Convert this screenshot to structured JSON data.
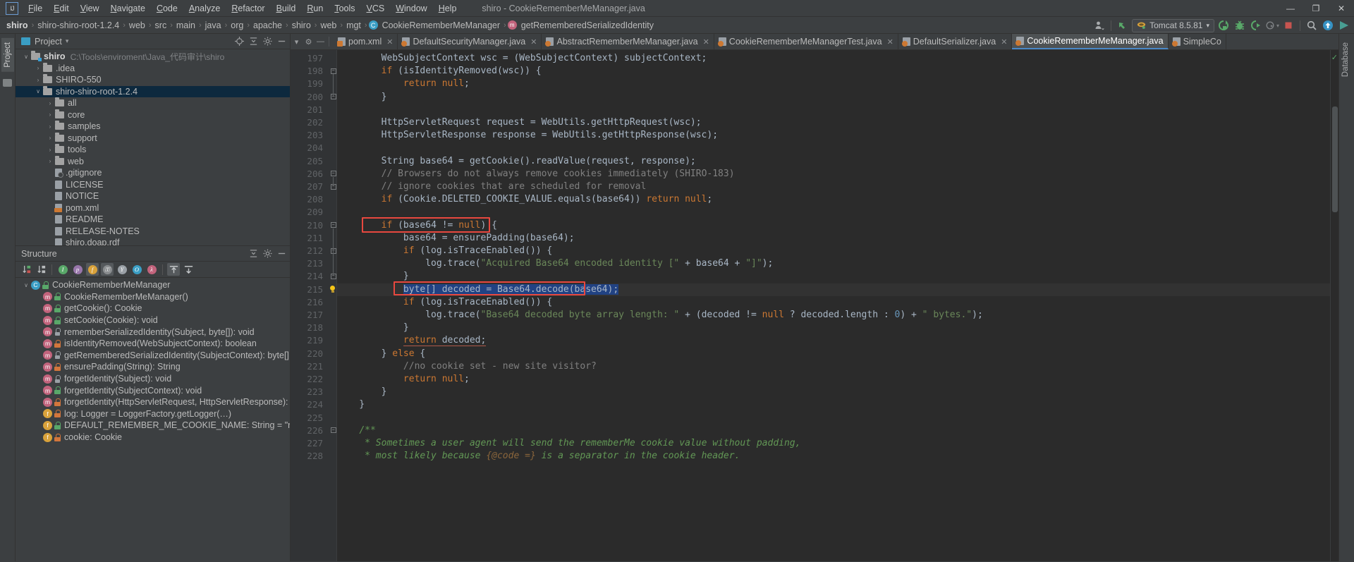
{
  "titlebar": {
    "logo": "IJ",
    "menus": [
      "File",
      "Edit",
      "View",
      "Navigate",
      "Code",
      "Analyze",
      "Refactor",
      "Build",
      "Run",
      "Tools",
      "VCS",
      "Window",
      "Help"
    ],
    "window_title": "shiro - CookieRememberMeManager.java",
    "minimize": "—",
    "maximize": "❐",
    "close": "✕"
  },
  "navbar": {
    "breadcrumbs": [
      {
        "label": "shiro",
        "bold": true,
        "icon": ""
      },
      {
        "label": "shiro-shiro-root-1.2.4",
        "bold": false,
        "icon": ""
      },
      {
        "label": "web",
        "bold": false,
        "icon": ""
      },
      {
        "label": "src",
        "bold": false,
        "icon": ""
      },
      {
        "label": "main",
        "bold": false,
        "icon": ""
      },
      {
        "label": "java",
        "bold": false,
        "icon": ""
      },
      {
        "label": "org",
        "bold": false,
        "icon": ""
      },
      {
        "label": "apache",
        "bold": false,
        "icon": ""
      },
      {
        "label": "shiro",
        "bold": false,
        "icon": ""
      },
      {
        "label": "web",
        "bold": false,
        "icon": ""
      },
      {
        "label": "mgt",
        "bold": false,
        "icon": ""
      },
      {
        "label": "CookieRememberMeManager",
        "bold": false,
        "icon": "class-icon",
        "badge": "C"
      },
      {
        "label": "getRememberedSerializedIdentity",
        "bold": false,
        "icon": "method-icon",
        "badge": "m"
      }
    ],
    "separator": "›",
    "run_config": "Tomcat 8.5.81",
    "toolbar_icons": [
      {
        "name": "user-icon",
        "glyph": "♟"
      },
      {
        "name": "update-project-icon",
        "glyph": "↖"
      },
      {
        "name": "run-icon",
        "glyph": "↻"
      },
      {
        "name": "debug-icon",
        "glyph": "☢"
      },
      {
        "name": "run-with-coverage-icon",
        "glyph": "▷"
      },
      {
        "name": "profile-icon",
        "glyph": "◴"
      },
      {
        "name": "stop-icon",
        "glyph": "■"
      },
      {
        "name": "search-everywhere-icon",
        "glyph": "⚲"
      },
      {
        "name": "upload-icon",
        "glyph": "↑"
      },
      {
        "name": "play-colored-icon",
        "glyph": "▶"
      }
    ]
  },
  "left_strip": {
    "project_tab": "Project",
    "structure_tab": ""
  },
  "right_strip": {
    "database_tab": "Database"
  },
  "project_panel": {
    "title": "Project",
    "dropdown": "▾",
    "actions": [
      "target-icon",
      "collapse-all-icon",
      "settings-icon",
      "hide-icon"
    ],
    "tree": [
      {
        "depth": 0,
        "arrow": "∨",
        "icon": "folder-module",
        "label": "shiro",
        "bold": true,
        "path": "C:\\Tools\\enviroment\\Java_代码审计\\shiro",
        "selected": false
      },
      {
        "depth": 1,
        "arrow": "›",
        "icon": "folder",
        "label": ".idea",
        "bold": false,
        "path": "",
        "selected": false
      },
      {
        "depth": 1,
        "arrow": "›",
        "icon": "folder",
        "label": "SHIRO-550",
        "bold": false,
        "path": "",
        "selected": false
      },
      {
        "depth": 1,
        "arrow": "∨",
        "icon": "folder",
        "label": "shiro-shiro-root-1.2.4",
        "bold": false,
        "path": "",
        "selected": true
      },
      {
        "depth": 2,
        "arrow": "›",
        "icon": "folder",
        "label": "all",
        "bold": false,
        "path": "",
        "selected": false
      },
      {
        "depth": 2,
        "arrow": "›",
        "icon": "folder",
        "label": "core",
        "bold": false,
        "path": "",
        "selected": false
      },
      {
        "depth": 2,
        "arrow": "›",
        "icon": "folder",
        "label": "samples",
        "bold": false,
        "path": "",
        "selected": false
      },
      {
        "depth": 2,
        "arrow": "›",
        "icon": "folder",
        "label": "support",
        "bold": false,
        "path": "",
        "selected": false
      },
      {
        "depth": 2,
        "arrow": "›",
        "icon": "folder",
        "label": "tools",
        "bold": false,
        "path": "",
        "selected": false
      },
      {
        "depth": 2,
        "arrow": "›",
        "icon": "folder",
        "label": "web",
        "bold": false,
        "path": "",
        "selected": false
      },
      {
        "depth": 2,
        "arrow": "",
        "icon": "file-git",
        "label": ".gitignore",
        "bold": false,
        "path": "",
        "selected": false
      },
      {
        "depth": 2,
        "arrow": "",
        "icon": "file",
        "label": "LICENSE",
        "bold": false,
        "path": "",
        "selected": false
      },
      {
        "depth": 2,
        "arrow": "",
        "icon": "file",
        "label": "NOTICE",
        "bold": false,
        "path": "",
        "selected": false
      },
      {
        "depth": 2,
        "arrow": "",
        "icon": "file-xml",
        "label": "pom.xml",
        "bold": false,
        "path": "",
        "selected": false
      },
      {
        "depth": 2,
        "arrow": "",
        "icon": "file",
        "label": "README",
        "bold": false,
        "path": "",
        "selected": false
      },
      {
        "depth": 2,
        "arrow": "",
        "icon": "file",
        "label": "RELEASE-NOTES",
        "bold": false,
        "path": "",
        "selected": false
      },
      {
        "depth": 2,
        "arrow": "",
        "icon": "file",
        "label": "shiro.doap.rdf",
        "bold": false,
        "path": "",
        "selected": false
      }
    ]
  },
  "structure_panel": {
    "title": "Structure",
    "toolbar": [
      {
        "name": "sort-by-visibility-icon",
        "glyph": "↓",
        "sub": "▲",
        "on": false
      },
      {
        "name": "sort-alphabetically-icon",
        "glyph": "↓",
        "sub": "a\nz",
        "on": false
      },
      {
        "name": "show-inherited-icon",
        "glyph": "I",
        "color": "#59a869",
        "on": false
      },
      {
        "name": "show-properties-icon",
        "glyph": "p",
        "color": "#9876aa",
        "on": false
      },
      {
        "name": "show-fields-icon",
        "glyph": "f",
        "color": "#d9a23b",
        "on": true
      },
      {
        "name": "show-non-public-icon",
        "glyph": "⚿",
        "color": "#8a8d8f",
        "on": true
      },
      {
        "name": "group-methods-icon",
        "glyph": "Y",
        "color": "#9aa0a6",
        "on": false
      },
      {
        "name": "show-anonymous-icon",
        "glyph": "O",
        "color": "#3a9ec4",
        "on": false
      },
      {
        "name": "show-lambdas-icon",
        "glyph": "λ",
        "color": "#c2637c",
        "on": false
      },
      {
        "name": "expand-all-icon",
        "glyph": "⇧",
        "on": true
      },
      {
        "name": "collapse-all-icon",
        "glyph": "⇩",
        "on": false
      }
    ],
    "members": [
      {
        "depth": 0,
        "arrow": "∨",
        "kind": "class",
        "vis": "pub",
        "label": "CookieRememberMeManager"
      },
      {
        "depth": 1,
        "arrow": "",
        "kind": "method",
        "vis": "pub",
        "label": "CookieRememberMeManager()"
      },
      {
        "depth": 1,
        "arrow": "",
        "kind": "method",
        "vis": "pub",
        "label": "getCookie(): Cookie"
      },
      {
        "depth": 1,
        "arrow": "",
        "kind": "method",
        "vis": "pub",
        "label": "setCookie(Cookie): void"
      },
      {
        "depth": 1,
        "arrow": "",
        "kind": "method",
        "vis": "prot",
        "label": "rememberSerializedIdentity(Subject, byte[]): void"
      },
      {
        "depth": 1,
        "arrow": "",
        "kind": "method",
        "vis": "priv",
        "label": "isIdentityRemoved(WebSubjectContext): boolean"
      },
      {
        "depth": 1,
        "arrow": "",
        "kind": "method",
        "vis": "prot",
        "label": "getRememberedSerializedIdentity(SubjectContext): byte[]"
      },
      {
        "depth": 1,
        "arrow": "",
        "kind": "method",
        "vis": "priv",
        "label": "ensurePadding(String): String"
      },
      {
        "depth": 1,
        "arrow": "",
        "kind": "method",
        "vis": "prot",
        "label": "forgetIdentity(Subject): void"
      },
      {
        "depth": 1,
        "arrow": "",
        "kind": "method",
        "vis": "pub",
        "label": "forgetIdentity(SubjectContext): void"
      },
      {
        "depth": 1,
        "arrow": "",
        "kind": "method",
        "vis": "priv",
        "label": "forgetIdentity(HttpServletRequest, HttpServletResponse): void"
      },
      {
        "depth": 1,
        "arrow": "",
        "kind": "field-static",
        "vis": "priv",
        "label": "log: Logger = LoggerFactory.getLogger(…)"
      },
      {
        "depth": 1,
        "arrow": "",
        "kind": "field-static",
        "vis": "pub",
        "label": "DEFAULT_REMEMBER_ME_COOKIE_NAME: String = \"rememberMe\""
      },
      {
        "depth": 1,
        "arrow": "",
        "kind": "field",
        "vis": "priv",
        "label": "cookie: Cookie"
      }
    ]
  },
  "editor": {
    "tab_controls": [
      "select-opened-file-icon",
      "settings-icon",
      "hide-icon"
    ],
    "tabs": [
      {
        "label": "pom.xml",
        "icon": "xml-file-icon",
        "active": false,
        "closable": true
      },
      {
        "label": "DefaultSecurityManager.java",
        "icon": "java-file-icon",
        "active": false,
        "closable": true
      },
      {
        "label": "AbstractRememberMeManager.java",
        "icon": "java-file-icon",
        "active": false,
        "closable": true
      },
      {
        "label": "CookieRememberMeManagerTest.java",
        "icon": "java-file-icon",
        "active": false,
        "closable": true
      },
      {
        "label": "DefaultSerializer.java",
        "icon": "java-file-icon",
        "active": false,
        "closable": true
      },
      {
        "label": "CookieRememberMeManager.java",
        "icon": "java-file-icon",
        "active": true,
        "closable": false
      },
      {
        "label": "SimpleCo",
        "icon": "java-file-icon",
        "active": false,
        "closable": false
      }
    ],
    "first_line_number": 197,
    "inspection_status": "✓",
    "lines": [
      {
        "n": 197,
        "indent": 0,
        "fold": "",
        "html": "        WebSubjectContext wsc = (WebSubjectContext) subjectContext;"
      },
      {
        "n": 198,
        "indent": 0,
        "fold": "open",
        "html": "        <span class='kw'>if</span> (isIdentityRemoved(wsc)) {"
      },
      {
        "n": 199,
        "indent": 0,
        "fold": "",
        "html": "            <span class='kw'>return</span> <span class='kw'>null</span>;"
      },
      {
        "n": 200,
        "indent": 0,
        "fold": "close",
        "html": "        }"
      },
      {
        "n": 201,
        "indent": 0,
        "fold": "",
        "html": ""
      },
      {
        "n": 202,
        "indent": 0,
        "fold": "",
        "html": "        HttpServletRequest request = WebUtils.getHttpRequest(wsc);"
      },
      {
        "n": 203,
        "indent": 0,
        "fold": "",
        "html": "        HttpServletResponse response = WebUtils.getHttpResponse(wsc);"
      },
      {
        "n": 204,
        "indent": 0,
        "fold": "",
        "html": ""
      },
      {
        "n": 205,
        "indent": 0,
        "fold": "",
        "html": "        String base64 = getCookie().readValue(request, response);"
      },
      {
        "n": 206,
        "indent": 0,
        "fold": "open",
        "html": "        <span class='cmt'>// Browsers do not always remove cookies immediately (SHIRO-183)</span>"
      },
      {
        "n": 207,
        "indent": 0,
        "fold": "close",
        "html": "        <span class='cmt'>// ignore cookies that are scheduled for removal</span>"
      },
      {
        "n": 208,
        "indent": 0,
        "fold": "",
        "html": "        <span class='kw'>if</span> (Cookie.DELETED_COOKIE_VALUE.equals(base64)) <span class='kw'>return</span> <span class='kw'>null</span>;"
      },
      {
        "n": 209,
        "indent": 0,
        "fold": "",
        "html": ""
      },
      {
        "n": 210,
        "indent": 0,
        "fold": "open",
        "html": "        <span class='kw'>if</span> (base64 != <span class='kw'>null</span>) {"
      },
      {
        "n": 211,
        "indent": 0,
        "fold": "",
        "html": "            base64 = ensurePadding(base64);"
      },
      {
        "n": 212,
        "indent": 0,
        "fold": "open",
        "html": "            <span class='kw'>if</span> (log.isTraceEnabled()) {"
      },
      {
        "n": 213,
        "indent": 0,
        "fold": "",
        "html": "                log.trace(<span class='str'>\"Acquired Base64 encoded identity [\"</span> + base64 + <span class='str'>\"]\"</span>);"
      },
      {
        "n": 214,
        "indent": 0,
        "fold": "close",
        "html": "            }"
      },
      {
        "n": 215,
        "indent": 0,
        "fold": "",
        "html": "            <span class='sel-hl'>byte[] decoded = Base64.decode(base64);</span>"
      },
      {
        "n": 216,
        "indent": 0,
        "fold": "",
        "html": "            <span class='kw'>if</span> (log.isTraceEnabled()) {"
      },
      {
        "n": 217,
        "indent": 0,
        "fold": "",
        "html": "                log.trace(<span class='str'>\"Base64 decoded byte array length: \"</span> + (decoded != <span class='kw'>null</span> ? decoded.length : <span class='num'>0</span>) + <span class='str'>\" bytes.\"</span>);"
      },
      {
        "n": 218,
        "indent": 0,
        "fold": "",
        "html": "            }"
      },
      {
        "n": 219,
        "indent": 0,
        "fold": "",
        "html": "            <span class='underline-red'><span class='kw'>return</span> decoded;</span>"
      },
      {
        "n": 220,
        "indent": 0,
        "fold": "",
        "html": "        } <span class='kw'>else</span> {"
      },
      {
        "n": 221,
        "indent": 0,
        "fold": "",
        "html": "            <span class='cmt'>//no cookie set - new site visitor?</span>"
      },
      {
        "n": 222,
        "indent": 0,
        "fold": "",
        "html": "            <span class='kw'>return</span> <span class='kw'>null</span>;"
      },
      {
        "n": 223,
        "indent": 0,
        "fold": "",
        "html": "        }"
      },
      {
        "n": 224,
        "indent": 0,
        "fold": "",
        "html": "    }"
      },
      {
        "n": 225,
        "indent": 0,
        "fold": "",
        "html": ""
      },
      {
        "n": 226,
        "indent": 0,
        "fold": "open",
        "html": "    <span class='cmtb'>/**</span>"
      },
      {
        "n": 227,
        "indent": 0,
        "fold": "",
        "html": "     <span class='cmtb'>* Sometimes a user agent will send the rememberMe cookie value without padding,</span>"
      },
      {
        "n": 228,
        "indent": 0,
        "fold": "",
        "html": "     <span class='cmtb'>* most likely because </span><span class='tag'>{@code =}</span><span class='cmtb'> is a separator in the cookie header.</span>"
      }
    ],
    "annotations": {
      "box1_line": 210,
      "box2_line": 215,
      "caret_line": 215,
      "bulb_line": 215,
      "box_color": "#e8483f"
    }
  }
}
